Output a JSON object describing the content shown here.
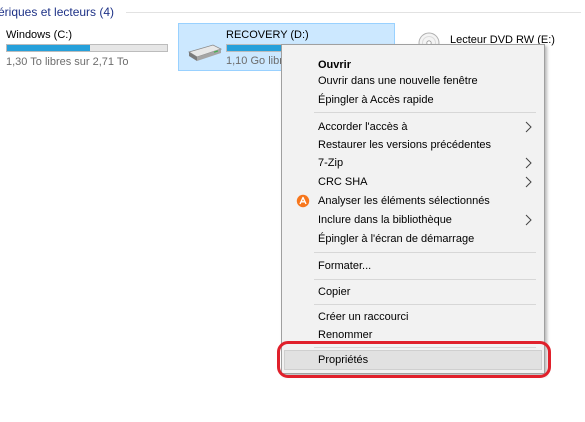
{
  "section": {
    "title": "ériques et lecteurs (4)"
  },
  "drives": [
    {
      "name": "Windows (C:)",
      "space": "1,30 To libres sur 2,71 To",
      "used_fraction": 0.52
    },
    {
      "name": "RECOVERY (D:)",
      "space": "1,10 Go libres",
      "used_fraction": 0.88
    },
    {
      "name": "Lecteur DVD RW (E:)"
    }
  ],
  "context_menu": {
    "items": [
      {
        "label": "Ouvrir"
      },
      {
        "label": "Ouvrir dans une nouvelle fenêtre"
      },
      {
        "label": "Épingler à Accès rapide"
      },
      {
        "label": "Accorder l'accès à"
      },
      {
        "label": "Restaurer les versions précédentes"
      },
      {
        "label": "7-Zip"
      },
      {
        "label": "CRC SHA"
      },
      {
        "label": "Analyser les éléments sélectionnés",
        "icon": "avast-icon"
      },
      {
        "label": "Inclure dans la bibliothèque"
      },
      {
        "label": "Épingler à l'écran de démarrage"
      },
      {
        "label": "Formater..."
      },
      {
        "label": "Copier"
      },
      {
        "label": "Créer un raccourci"
      },
      {
        "label": "Renommer"
      },
      {
        "label": "Propriétés"
      }
    ]
  },
  "colors": {
    "bar_fill": "#26a0da",
    "selection_bg": "#cce8ff",
    "highlight_ring": "#e0202b",
    "avast_orange": "#f7761c"
  }
}
